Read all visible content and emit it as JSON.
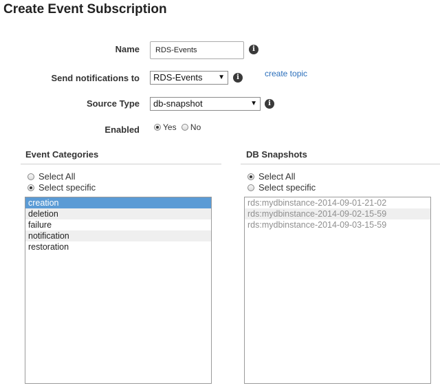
{
  "page": {
    "title": "Create Event Subscription"
  },
  "form": {
    "name": {
      "label": "Name",
      "value": "RDS-Events"
    },
    "send_notifications": {
      "label": "Send notifications to",
      "selected": "RDS-Events",
      "link": "create topic"
    },
    "source_type": {
      "label": "Source Type",
      "selected": "db-snapshot"
    },
    "enabled": {
      "label": "Enabled",
      "options": [
        "Yes",
        "No"
      ],
      "selected": "Yes"
    }
  },
  "event_categories": {
    "title": "Event Categories",
    "options": [
      "Select All",
      "Select specific"
    ],
    "selected_option": "Select specific",
    "items": [
      "creation",
      "deletion",
      "failure",
      "notification",
      "restoration"
    ],
    "selected_item": "creation"
  },
  "db_snapshots": {
    "title": "DB Snapshots",
    "options": [
      "Select All",
      "Select specific"
    ],
    "selected_option": "Select All",
    "items": [
      "rds:mydbinstance-2014-09-01-21-02",
      "rds:mydbinstance-2014-09-02-15-59",
      "rds:mydbinstance-2014-09-03-15-59"
    ]
  },
  "icons": {
    "info": "info-icon",
    "dropdown": "chevron-down-icon",
    "info_glyph": "i",
    "dropdown_glyph": "▼"
  },
  "colors": {
    "selection": "#5b9bd5",
    "link": "#2a6ebb"
  }
}
